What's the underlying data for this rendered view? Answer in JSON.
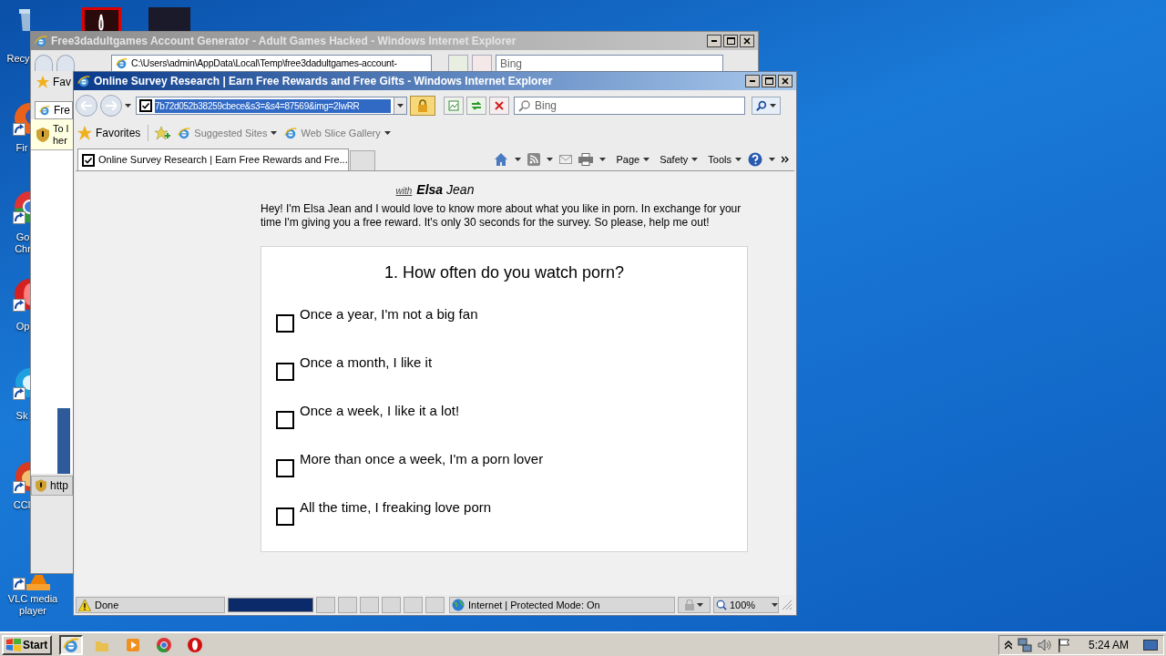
{
  "desktop": {
    "icons": [
      {
        "kind": "recycle",
        "lines": [
          "Recy"
        ]
      },
      {
        "kind": "acrobat"
      },
      {
        "kind": "dark"
      },
      {
        "kind": "firefox",
        "lines": [
          "Fir"
        ]
      },
      {
        "kind": "chrome",
        "lines": [
          "Go",
          "Chr"
        ]
      },
      {
        "kind": "opera",
        "lines": [
          "Op"
        ]
      },
      {
        "kind": "skype",
        "lines": [
          "Sk"
        ]
      },
      {
        "kind": "ccleaner",
        "lines": [
          "CCl"
        ]
      },
      {
        "kind": "vlc",
        "lines": [
          "VLC media",
          "player"
        ]
      }
    ]
  },
  "back_window": {
    "title": "Free3dadultgames Account Generator - Adult Games Hacked - Windows Internet Explorer",
    "address": "C:\\Users\\admin\\AppData\\Local\\Temp\\free3dadultgames-account-",
    "search_placeholder": "Bing",
    "favorites": "Fav",
    "tab": "Fre",
    "info_bar": [
      "To l",
      "her"
    ],
    "status": "http"
  },
  "window": {
    "title": "Online Survey Research | Earn Free Rewards and Free Gifts - Windows Internet Explorer",
    "address": "7b72d052b38259cbece&s3=&s4=87569&img=2IwRR",
    "search_placeholder": "Bing",
    "favorites": "Favorites",
    "favorites_bar": [
      "Suggested Sites",
      "Web Slice Gallery"
    ],
    "tabs": [
      {
        "label": "Online Survey Research | Earn Free Rewards and Fre...",
        "selected": true
      }
    ],
    "command_bar": [
      "Page",
      "Safety",
      "Tools"
    ]
  },
  "page": {
    "byline": {
      "prefix": "with",
      "name": "**Elsa** Jean"
    },
    "intro": "Hey! I'm Elsa Jean and I would love to know more about what you like in porn. In exchange for your time I'm giving you a free reward. It's only 30 seconds for the survey. So please, help me out!",
    "survey": {
      "question": "1. How often do you watch porn?",
      "options": [
        {
          "label": "Once a year, I'm not a big fan",
          "checked": false
        },
        {
          "label": "Once a month, I like it",
          "checked": false
        },
        {
          "label": "Once a week, I like it a lot!",
          "checked": false
        },
        {
          "label": "More than once a week, I'm a porn lover",
          "checked": false
        },
        {
          "label": "All the time, I freaking love porn",
          "checked": false
        }
      ]
    }
  },
  "status_bar": {
    "text": "Done",
    "progress": {
      "level": 1
    },
    "zone": "Internet | Protected Mode: On",
    "zoom": "100%"
  },
  "taskbar": {
    "start": "Start",
    "apps": [
      {
        "kind": "ie",
        "selected": true
      },
      {
        "kind": "folder",
        "selected": false
      },
      {
        "kind": "media",
        "selected": false
      },
      {
        "kind": "chrome",
        "selected": false
      },
      {
        "kind": "opera",
        "selected": false
      }
    ],
    "clock": "5:24 AM"
  }
}
